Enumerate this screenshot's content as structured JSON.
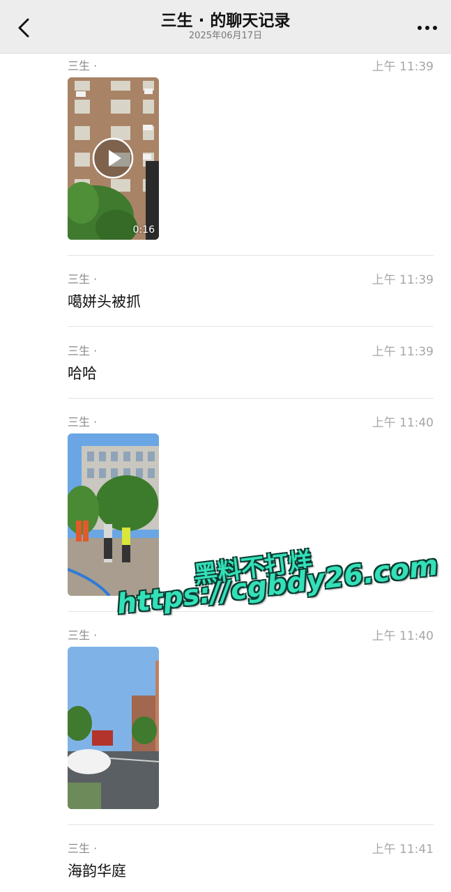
{
  "header": {
    "title": "三生 · 的聊天记录",
    "subtitle": "2025年06月17日",
    "back_icon": "chevron-left-icon",
    "more_icon": "more-dots-icon"
  },
  "messages": [
    {
      "sender": "三生 ·",
      "time": "上午 11:39",
      "type": "video",
      "duration": "0:16"
    },
    {
      "sender": "三生 ·",
      "time": "上午 11:39",
      "type": "text",
      "text": "噶姘头被抓"
    },
    {
      "sender": "三生 ·",
      "time": "上午 11:39",
      "type": "text",
      "text": "哈哈"
    },
    {
      "sender": "三生 ·",
      "time": "上午 11:40",
      "type": "image"
    },
    {
      "sender": "三生 ·",
      "time": "上午 11:40",
      "type": "image"
    },
    {
      "sender": "三生 ·",
      "time": "上午 11:41",
      "type": "text",
      "text": "海韵华庭"
    }
  ],
  "watermark": {
    "line1": "黑料不打烊",
    "line2": "https://cgbdy26.com",
    "color": "#33e0b8"
  }
}
